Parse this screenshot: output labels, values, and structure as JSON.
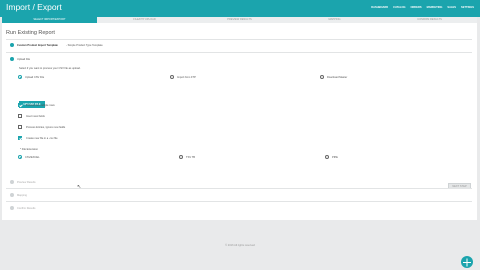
{
  "app": {
    "title": "Import / Export"
  },
  "topnav": [
    "DASHBOARD",
    "CATALOG",
    "ORDERS",
    "MARKETING",
    "SALES",
    "SETTINGS"
  ],
  "steps": [
    {
      "label": "SELECT IMPORT/EXPORT",
      "active": true
    },
    {
      "label": "FILE/FTP UPLOAD",
      "active": false
    },
    {
      "label": "PREVIEW RESULTS",
      "active": false
    },
    {
      "label": "MAPPING",
      "active": false
    },
    {
      "label": "CONFIRM RESULTS",
      "active": false
    }
  ],
  "page_title": "Run Existing Report",
  "step1": {
    "title": "Custom Product Import Template",
    "subtitle": "- Simple Product Type Template"
  },
  "step2": {
    "title": "Upload File",
    "help": "Select if you want to process your CSV file as upload.",
    "sources": [
      "Upload CSV File",
      "Import from FTP",
      "Download Master"
    ],
    "upload_button": "UPLOAD FILE"
  },
  "options": [
    {
      "label": "Process as multiple rows",
      "checked": true
    },
    {
      "label": "Insert new fields",
      "checked": false
    },
    {
      "label": "Process Entries, Ignore new fields",
      "checked": false
    },
    {
      "label": "Create new file in a .csv file",
      "checked": true
    }
  ],
  "file_extension": {
    "label": "* File Extension",
    "choices": [
      "CSV/EXCEL",
      "TSV TB",
      "PIPE"
    ]
  },
  "next_button": "NEXT STEP",
  "collapsed_steps": [
    "Preview Results",
    "Mapping",
    "Confirm Results"
  ],
  "footer": "© 2016 All rights reserved"
}
